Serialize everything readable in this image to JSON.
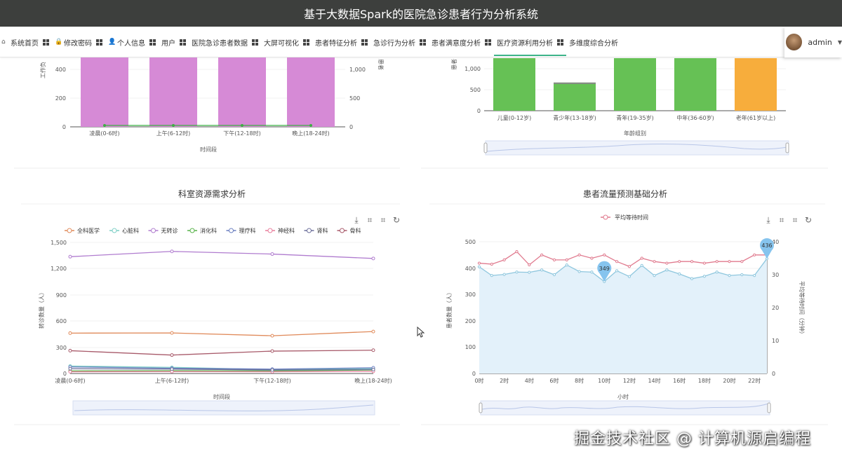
{
  "app": {
    "title": "基于大数据Spark的医院急诊患者行为分析系统"
  },
  "nav": {
    "items": [
      {
        "label": "系统首页",
        "icon": "home-icon"
      },
      {
        "label": "修改密码",
        "icon": "lock-icon"
      },
      {
        "label": "个人信息",
        "icon": "user-icon"
      },
      {
        "label": "用户",
        "icon": "grid-icon"
      },
      {
        "label": "医院急诊患者数据",
        "icon": "grid-icon"
      },
      {
        "label": "大屏可视化",
        "icon": "grid-icon"
      },
      {
        "label": "患者特征分析",
        "icon": "grid-icon"
      },
      {
        "label": "急诊行为分析",
        "icon": "grid-icon"
      },
      {
        "label": "患者满意度分析",
        "icon": "grid-icon"
      },
      {
        "label": "医疗资源利用分析",
        "icon": "grid-icon"
      },
      {
        "label": "多维度综合分析",
        "icon": "grid-icon"
      }
    ],
    "active_index": 9
  },
  "user": {
    "name": "admin"
  },
  "colors": {
    "topbar": "#3d3f3d",
    "accent": "#3db389"
  },
  "charts": {
    "top_left": {
      "xlabel": "时间段",
      "ylabel_left": "工作负",
      "ylabel_right": "患者"
    },
    "top_right": {
      "xlabel": "年龄组别",
      "ylabel": "患者"
    },
    "bottom_left": {
      "title": "科室资源需求分析",
      "xlabel": "时间段",
      "ylabel": "转诊数量（人）"
    },
    "bottom_right": {
      "title": "患者流量预测基础分析",
      "xlabel": "小时",
      "ylabel_left": "患者数量（人）",
      "ylabel_right": "平均等待时间（分钟）"
    }
  },
  "toolbox": [
    "download-icon",
    "zoom-icon",
    "zoom-reset-icon",
    "restore-icon"
  ],
  "watermark": "掘金技术社区 @ 计算机源启编程",
  "chart_data": [
    {
      "type": "bar",
      "categories": [
        "凌晨(0-6时)",
        "上午(6-12时)",
        "下午(12-18时)",
        "晚上(18-24时)"
      ],
      "series": [
        {
          "values": [
            500,
            500,
            500,
            500
          ],
          "color": "#d68ad6"
        },
        {
          "values": [
            8,
            8,
            8,
            8
          ],
          "color": "#3cb043"
        }
      ],
      "yticks_left": [
        "0",
        "200",
        "400"
      ],
      "yticks_right": [
        "0",
        "500",
        "1,000"
      ],
      "ylim": [
        0,
        500
      ]
    },
    {
      "type": "bar",
      "categories": [
        "儿童(0-12岁)",
        "青少年(13-18岁)",
        "青年(19-35岁)",
        "中年(36-60岁)",
        "老年(61岁以上)"
      ],
      "values": [
        1250,
        670,
        1250,
        1250,
        1250
      ],
      "colors": [
        "#66c155",
        "#66c155",
        "#66c155",
        "#66c155",
        "#f7ad3c"
      ],
      "yticks": [
        "0",
        "500",
        "1,000"
      ],
      "ylim": [
        0,
        1250
      ]
    },
    {
      "type": "line",
      "categories": [
        "凌晨(0-6时)",
        "上午(6-12时)",
        "下午(12-18时)",
        "晚上(18-24时)"
      ],
      "series": [
        {
          "name": "全科医学",
          "color": "#e08a5a",
          "values": [
            460,
            462,
            430,
            478
          ]
        },
        {
          "name": "心脏科",
          "color": "#7ecfc6",
          "values": [
            85,
            70,
            45,
            55
          ]
        },
        {
          "name": "无转诊",
          "color": "#b07ccf",
          "values": [
            1330,
            1390,
            1360,
            1310
          ]
        },
        {
          "name": "消化科",
          "color": "#59b34a",
          "values": [
            30,
            32,
            30,
            40
          ]
        },
        {
          "name": "理疗科",
          "color": "#6a7fc0",
          "values": [
            75,
            60,
            50,
            65
          ]
        },
        {
          "name": "神经科",
          "color": "#e87d9b",
          "values": [
            20,
            22,
            20,
            25
          ]
        },
        {
          "name": "肾科",
          "color": "#6c6f9a",
          "values": [
            55,
            50,
            40,
            45
          ]
        },
        {
          "name": "骨科",
          "color": "#a85a6a",
          "values": [
            260,
            210,
            255,
            265
          ]
        }
      ],
      "yticks": [
        "0",
        "300",
        "600",
        "900",
        "1,200",
        "1,500"
      ],
      "ylim": [
        0,
        1500
      ]
    },
    {
      "type": "line",
      "x": [
        "0时",
        "1时",
        "2时",
        "3时",
        "4时",
        "5时",
        "6时",
        "7时",
        "8时",
        "9时",
        "10时",
        "11时",
        "12时",
        "13时",
        "14时",
        "15时",
        "16时",
        "17时",
        "18时",
        "19时",
        "20时",
        "21时",
        "22时",
        "23时"
      ],
      "xticks": [
        "0时",
        "2时",
        "4时",
        "6时",
        "8时",
        "10时",
        "12时",
        "14时",
        "16时",
        "18时",
        "20时",
        "22时"
      ],
      "series": [
        {
          "name": "患者数量",
          "axis": "left",
          "color": "#8fc7de",
          "area": true,
          "values": [
            405,
            372,
            376,
            385,
            384,
            393,
            375,
            412,
            387,
            385,
            349,
            390,
            368,
            410,
            372,
            393,
            378,
            360,
            369,
            385,
            372,
            375,
            372,
            436
          ]
        },
        {
          "name": "平均等待时间",
          "axis": "right",
          "color": "#e07a8e",
          "values": [
            33.5,
            33.2,
            34.5,
            37,
            33,
            36,
            34.5,
            34.5,
            36,
            35,
            36,
            34,
            32.5,
            35,
            34,
            33.5,
            34,
            34,
            33.5,
            34,
            34,
            34,
            36,
            36
          ]
        }
      ],
      "markers": [
        "349",
        "436"
      ],
      "yticks_left": [
        "0",
        "100",
        "200",
        "300",
        "400",
        "500"
      ],
      "yticks_right": [
        "0",
        "10",
        "20",
        "30",
        "40"
      ],
      "ylim_left": [
        0,
        500
      ],
      "ylim_right": [
        0,
        40
      ]
    }
  ]
}
